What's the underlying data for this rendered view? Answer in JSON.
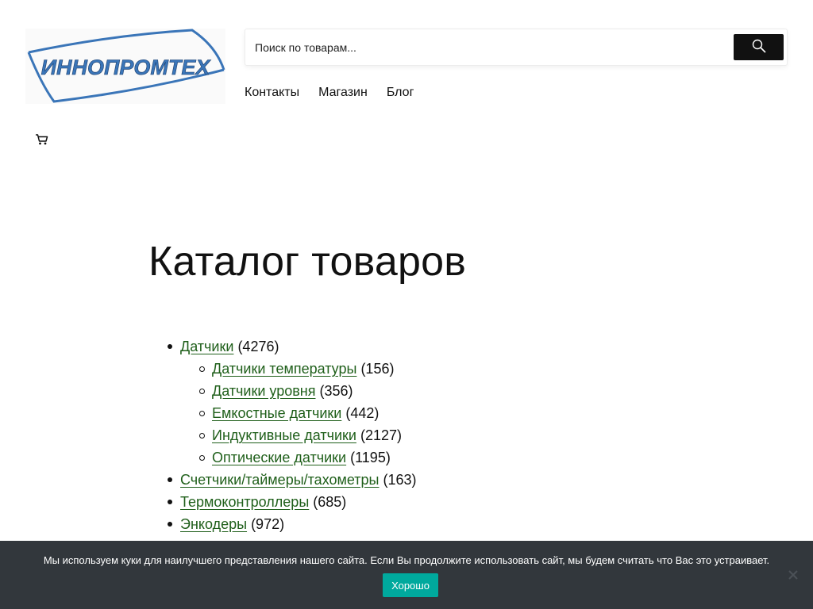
{
  "header": {
    "logo_text": "ИННОПРОМТЕХ",
    "search": {
      "placeholder": "Поиск по товарам..."
    },
    "nav": [
      {
        "label": "Контакты"
      },
      {
        "label": "Магазин"
      },
      {
        "label": "Блог"
      }
    ]
  },
  "main": {
    "title": "Каталог товаров",
    "categories": [
      {
        "label": "Датчики",
        "count": "(4276)",
        "children": [
          {
            "label": "Датчики температуры",
            "count": "(156)"
          },
          {
            "label": "Датчики уровня",
            "count": "(356)"
          },
          {
            "label": "Емкостные датчики",
            "count": "(442)"
          },
          {
            "label": "Индуктивные датчики",
            "count": "(2127)"
          },
          {
            "label": "Оптические датчики",
            "count": "(1195)"
          }
        ]
      },
      {
        "label": "Счетчики/таймеры/тахометры",
        "count": "(163)"
      },
      {
        "label": "Термоконтроллеры",
        "count": "(685)"
      },
      {
        "label": "Энкодеры",
        "count": "(972)"
      }
    ]
  },
  "cookie_banner": {
    "text": "Мы используем куки для наилучшего представления нашего сайта. Если Вы продолжите использовать сайт, мы будем считать что Вас это устраивает.",
    "accept_label": "Хорошо"
  },
  "colors": {
    "link": "#1f5f1a",
    "logo_blue": "#3a75b8",
    "search_button": "#111111",
    "banner_bg": "#32373c",
    "accept_button": "#00a99d"
  },
  "icons": [
    "search-icon",
    "cart-icon",
    "close-icon"
  ]
}
